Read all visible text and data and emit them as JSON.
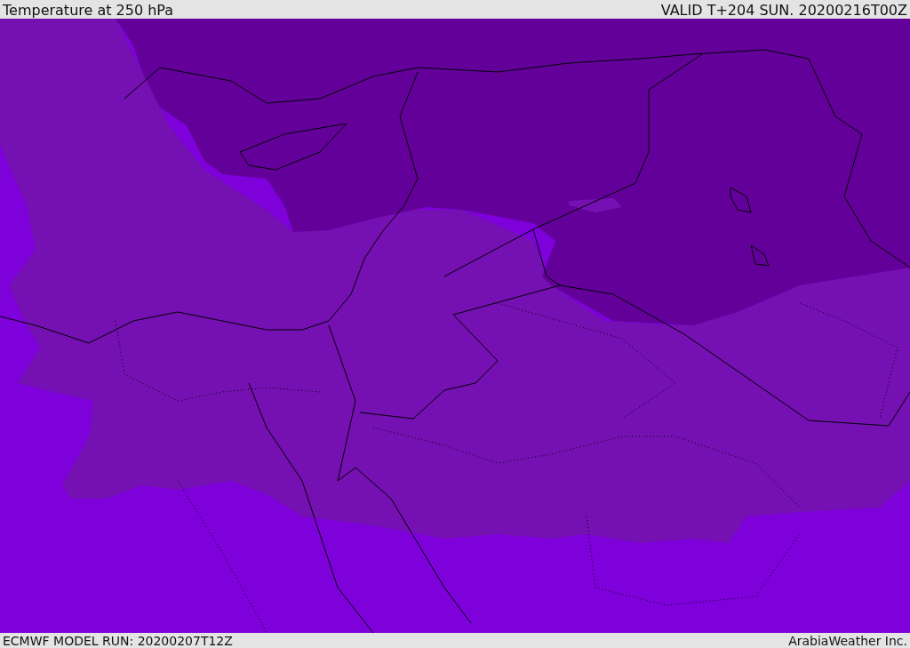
{
  "header": {
    "title": "Temperature at 250 hPa",
    "valid_time": "VALID T+204 SUN. 20200216T00Z"
  },
  "footer": {
    "model_run": "ECMWF MODEL RUN: 20200207T12Z",
    "credit": "ArabiaWeather Inc."
  }
}
